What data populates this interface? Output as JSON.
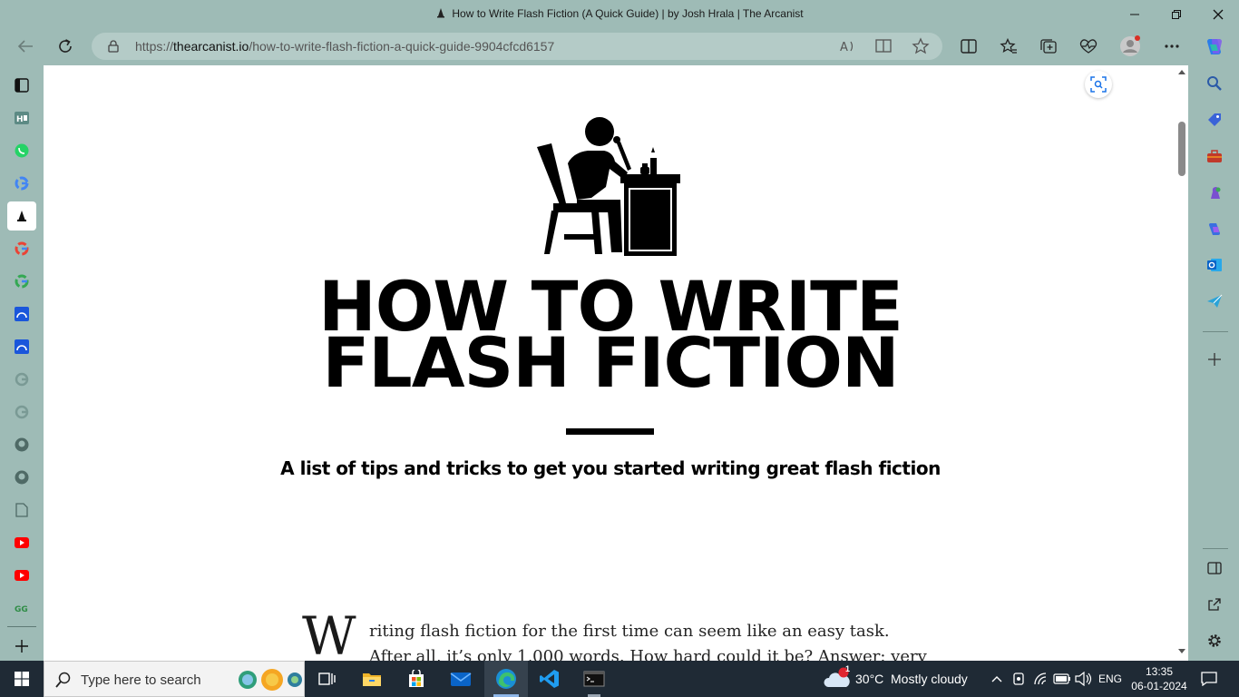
{
  "window": {
    "title": "How to Write Flash Fiction (A Quick Guide) | by Josh Hrala | The Arcanist"
  },
  "address_bar": {
    "url_prefix": "https://",
    "url_domain": "thearcanist.io",
    "url_path": "/how-to-write-flash-fiction-a-quick-guide-9904cfcd6157"
  },
  "article": {
    "hero_line1": "HOW TO WRITE",
    "hero_line2": "FLASH FICTION",
    "hero_subtitle": "A list of tips and tricks to get you started writing great flash fiction",
    "dropcap": "W",
    "paragraph": "riting flash fiction for the first time can seem like an easy task. After all, it’s only 1,000 words. How hard could it be? Answer: very hard."
  },
  "taskbar": {
    "search_placeholder": "Type here to search",
    "weather_temp": "30°C",
    "weather_desc": "Mostly cloudy",
    "weather_badge": "1",
    "language": "ENG",
    "time": "13:35",
    "date": "06-01-2024"
  },
  "colors": {
    "chrome_bg": "#9ebbb6",
    "taskbar_bg": "#1f2a35",
    "accent": "#1a73e8"
  }
}
